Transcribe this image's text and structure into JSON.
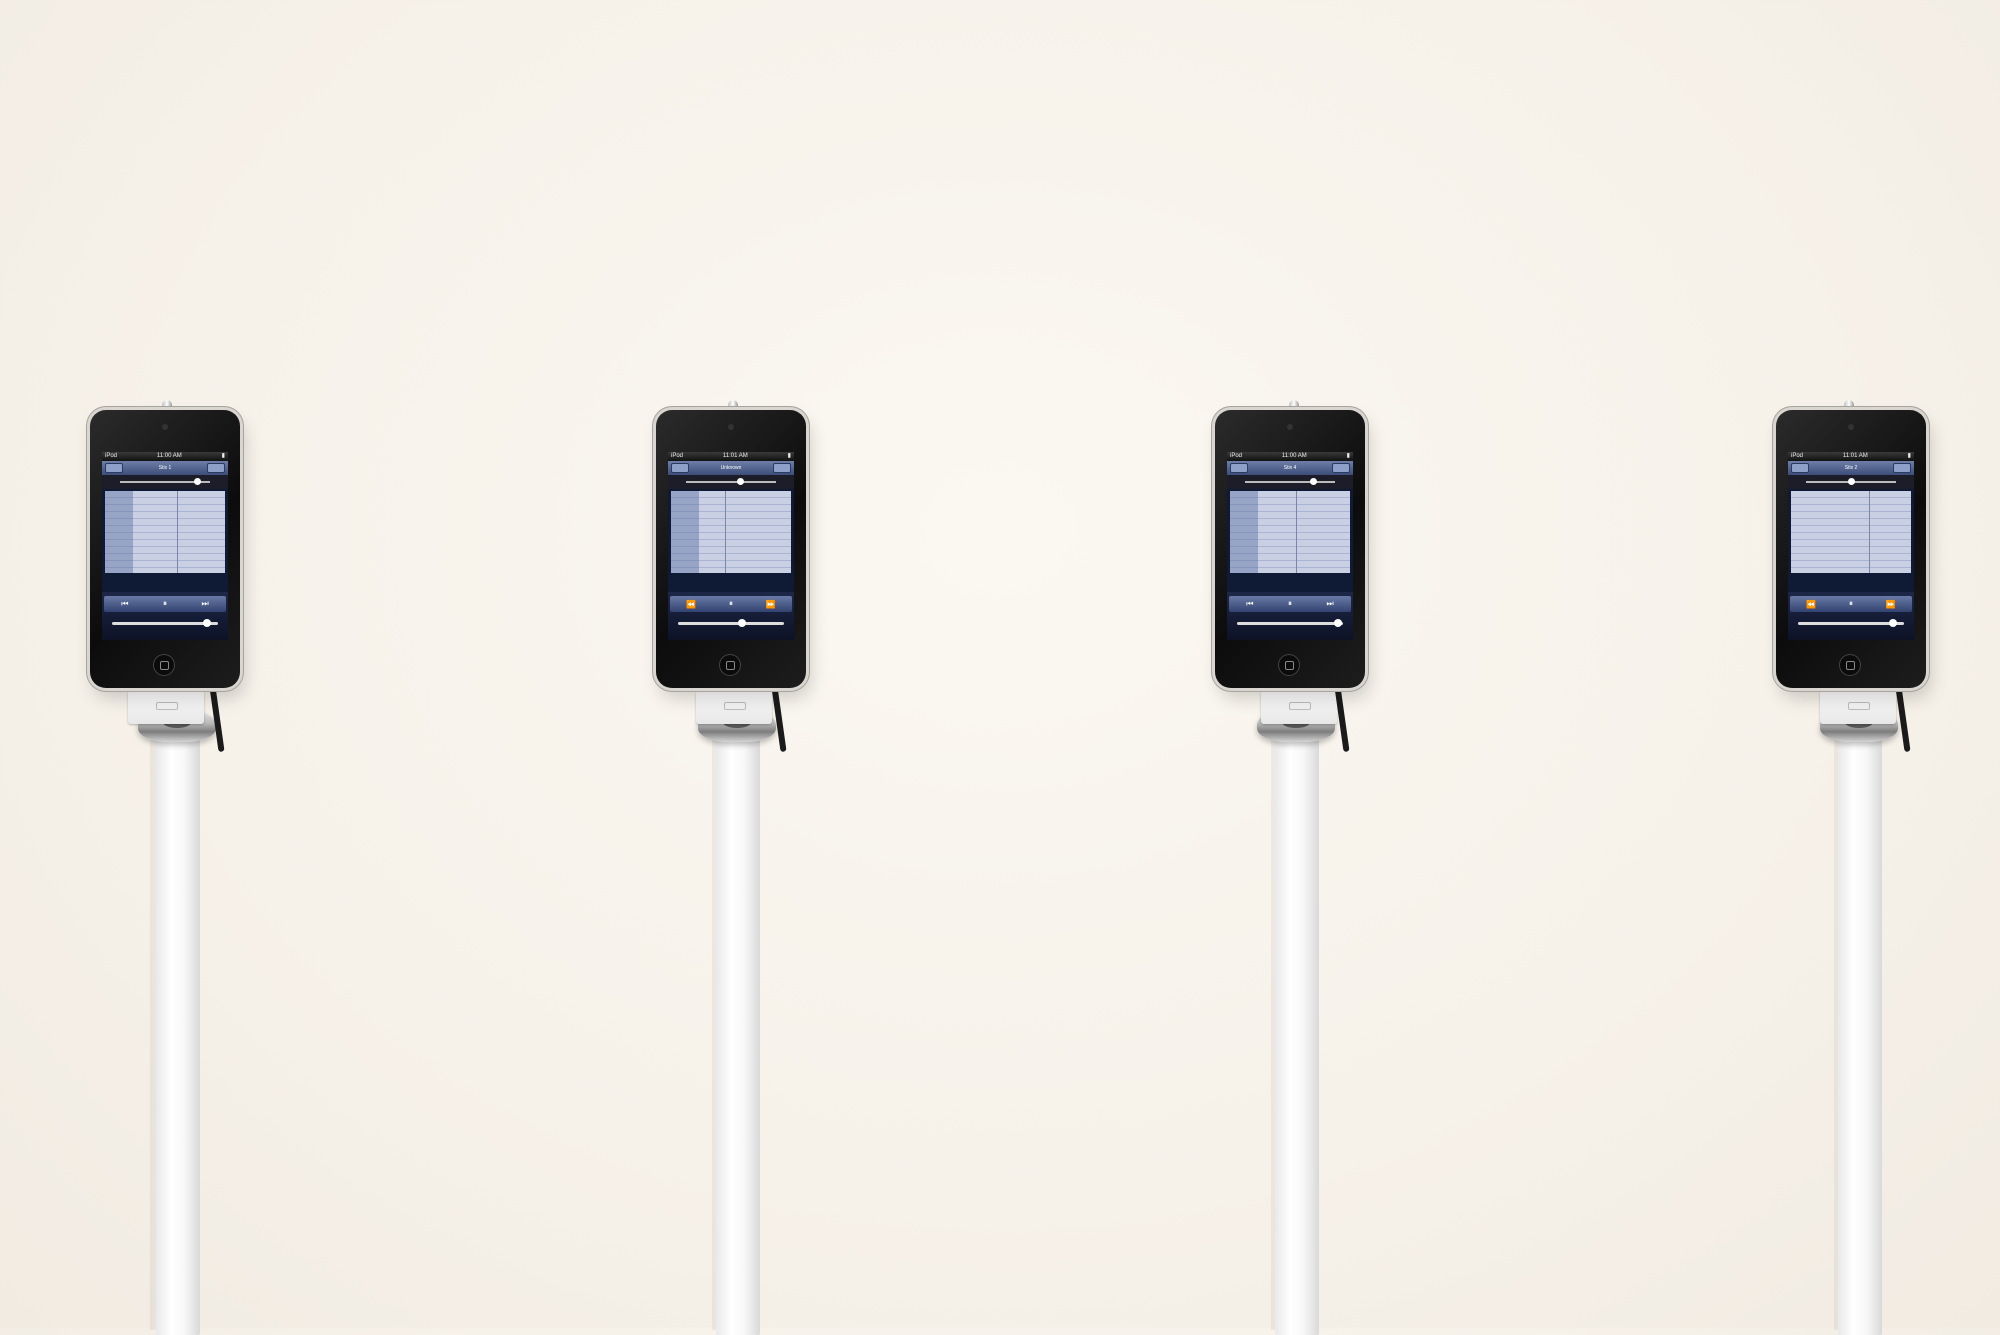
{
  "scene": {
    "background_color": "#f6f1e9"
  },
  "devices": [
    {
      "status_left": "iPod",
      "status_time": "11:00 AM",
      "nav_title": "Stix 1",
      "progress": 0.85,
      "volume": 0.9
    },
    {
      "status_left": "iPod",
      "status_time": "11:01 AM",
      "nav_title": "Unknown",
      "progress": 0.6,
      "volume": 0.6
    },
    {
      "status_left": "iPod",
      "status_time": "11:00 AM",
      "nav_title": "Stix 4",
      "progress": 0.75,
      "volume": 0.95
    },
    {
      "status_left": "iPod",
      "status_time": "11:01 AM",
      "nav_title": "Stix 2",
      "progress": 0.5,
      "volume": 0.9
    }
  ]
}
